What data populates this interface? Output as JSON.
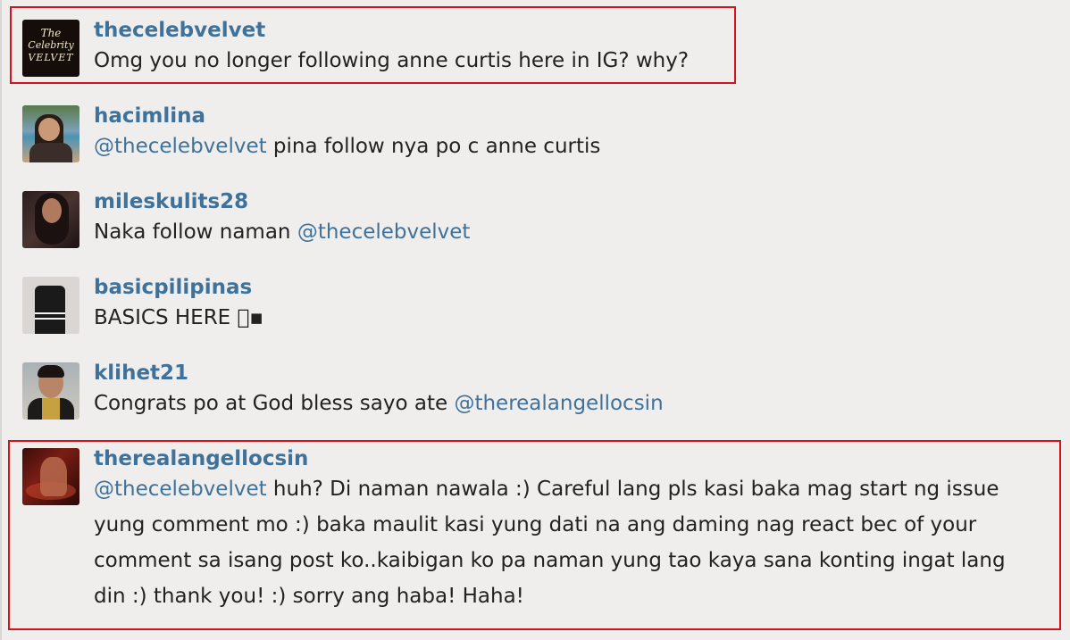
{
  "comments": [
    {
      "username": "thecelebvelvet",
      "avatar": {
        "icon": "celebvelvet-logo-avatar",
        "lines": [
          "The",
          "Celebrity",
          "VELVET"
        ]
      },
      "lines": [
        [
          {
            "text": "Omg you no longer following anne curtis here in IG? why?"
          }
        ]
      ],
      "highlighted": true
    },
    {
      "username": "hacimlina",
      "avatar": {
        "icon": "user-photo-avatar"
      },
      "lines": [
        [
          {
            "text": "@thecelebvelvet",
            "mention": true
          },
          {
            "text": " pina follow nya po c anne curtis"
          }
        ]
      ],
      "highlighted": false
    },
    {
      "username": "mileskulits28",
      "avatar": {
        "icon": "user-photo-avatar"
      },
      "lines": [
        [
          {
            "text": "Naka follow naman "
          },
          {
            "text": "@thecelebvelvet",
            "mention": true
          }
        ]
      ],
      "highlighted": false
    },
    {
      "username": "basicpilipinas",
      "avatar": {
        "icon": "user-photo-avatar"
      },
      "lines": [
        [
          {
            "text": "BASICS HERE 🏻▪"
          }
        ]
      ],
      "highlighted": false
    },
    {
      "username": "klihet21",
      "avatar": {
        "icon": "user-photo-avatar"
      },
      "lines": [
        [
          {
            "text": "Congrats po at God bless sayo ate "
          },
          {
            "text": "@therealangellocsin",
            "mention": true
          }
        ]
      ],
      "highlighted": false
    },
    {
      "username": "therealangellocsin",
      "avatar": {
        "icon": "user-photo-avatar"
      },
      "lines": [
        [
          {
            "text": "@thecelebvelvet",
            "mention": true
          },
          {
            "text": " huh? Di naman nawala :) Careful lang pls kasi baka mag start ng issue"
          }
        ],
        [
          {
            "text": "yung comment mo :) baka maulit kasi yung dati na ang daming nag react bec of your"
          }
        ],
        [
          {
            "text": "comment sa isang post ko..kaibigan ko pa naman yung tao kaya sana konting ingat lang"
          }
        ],
        [
          {
            "text": "din :) thank you! :) sorry ang haba! Haha!"
          }
        ]
      ],
      "highlighted": true
    }
  ],
  "colors": {
    "background": "#efeeec",
    "username": "#3f729b",
    "mention": "#3f729b",
    "text": "#222222",
    "highlight_border": "#d3141c"
  }
}
